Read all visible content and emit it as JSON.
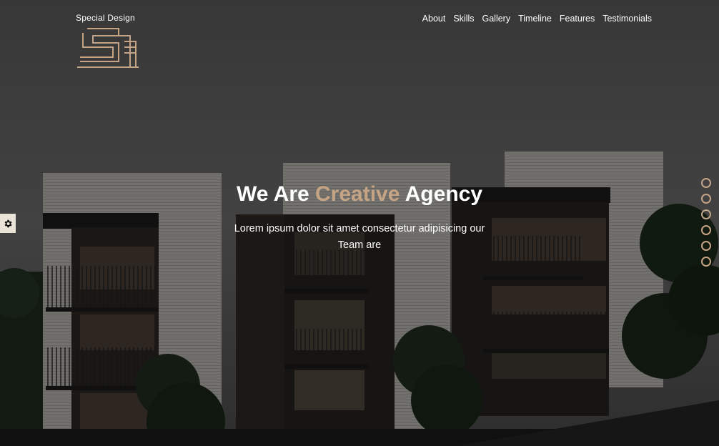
{
  "header": {
    "brand": "Special Design",
    "logo_icon": "building-s-logo-icon",
    "nav": [
      {
        "label": "About"
      },
      {
        "label": "Skills"
      },
      {
        "label": "Gallery"
      },
      {
        "label": "Timeline"
      },
      {
        "label": "Features"
      },
      {
        "label": "Testimonials"
      }
    ]
  },
  "hero": {
    "title_part1": "We Are ",
    "title_accent": "Creative",
    "title_part2": " Agency",
    "subtitle": "Lorem ipsum dolor sit amet consectetur adipisicing our Team are"
  },
  "settings": {
    "icon": "gear-icon"
  },
  "bullets": {
    "count": 6
  },
  "colors": {
    "accent": "#c4a484",
    "text": "#ffffff",
    "overlay": "#000000"
  }
}
